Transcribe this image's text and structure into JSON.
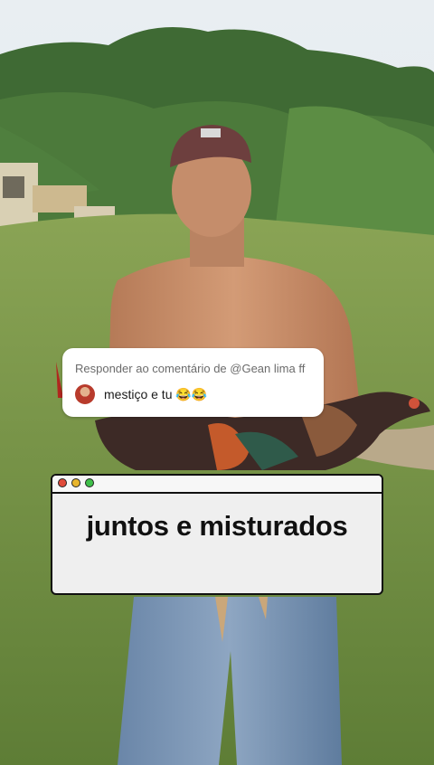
{
  "comment": {
    "header": "Responder ao comentário de @Gean lima ff",
    "text": "mestiço e tu 😂😂"
  },
  "caption": {
    "text": "juntos e misturados"
  },
  "window_controls": {
    "close_color": "#e04b3a",
    "minimize_color": "#e8b52c",
    "maximize_color": "#3fbf4a"
  }
}
